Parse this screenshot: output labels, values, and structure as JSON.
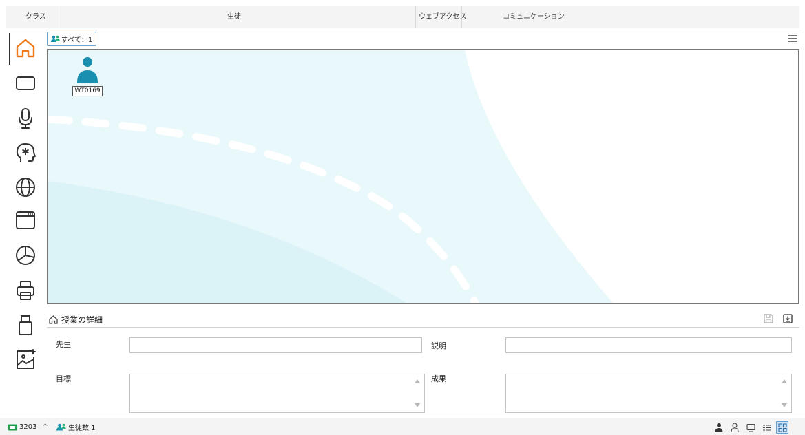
{
  "header": {
    "columns": [
      "クラス",
      "生徒",
      "ウェブアクセス",
      "コミュニケーション"
    ]
  },
  "sidebar": {
    "items": [
      {
        "name": "home-icon",
        "active": true
      },
      {
        "name": "screen-icon"
      },
      {
        "name": "microphone-icon"
      },
      {
        "name": "head-brain-icon"
      },
      {
        "name": "globe-icon"
      },
      {
        "name": "app-window-icon"
      },
      {
        "name": "pie-chart-icon"
      },
      {
        "name": "printer-icon"
      },
      {
        "name": "usb-drive-icon"
      },
      {
        "name": "image-icon"
      }
    ]
  },
  "filter": {
    "label": "すべて：1"
  },
  "canvas": {
    "students": [
      {
        "id": "WT0169"
      }
    ],
    "colors": {
      "background_light": "#e7f7fa",
      "background_mid": "#d9f1f6",
      "avatar": "#1a8fb0"
    }
  },
  "details": {
    "title": "授業の詳細",
    "fields": {
      "teacher_label": "先生",
      "description_label": "説明",
      "goal_label": "目標",
      "result_label": "成果",
      "teacher_value": "",
      "description_value": "",
      "goal_value": "",
      "result_value": ""
    }
  },
  "status_bar": {
    "device_count": "3203",
    "expand_glyph": "^",
    "student_count_label": "生徒数 1",
    "view_buttons": [
      "person-filled-icon",
      "person-outline-icon",
      "monitor-icon",
      "list-view-icon",
      "grid-view-icon"
    ],
    "active_view": "grid-view-icon"
  }
}
